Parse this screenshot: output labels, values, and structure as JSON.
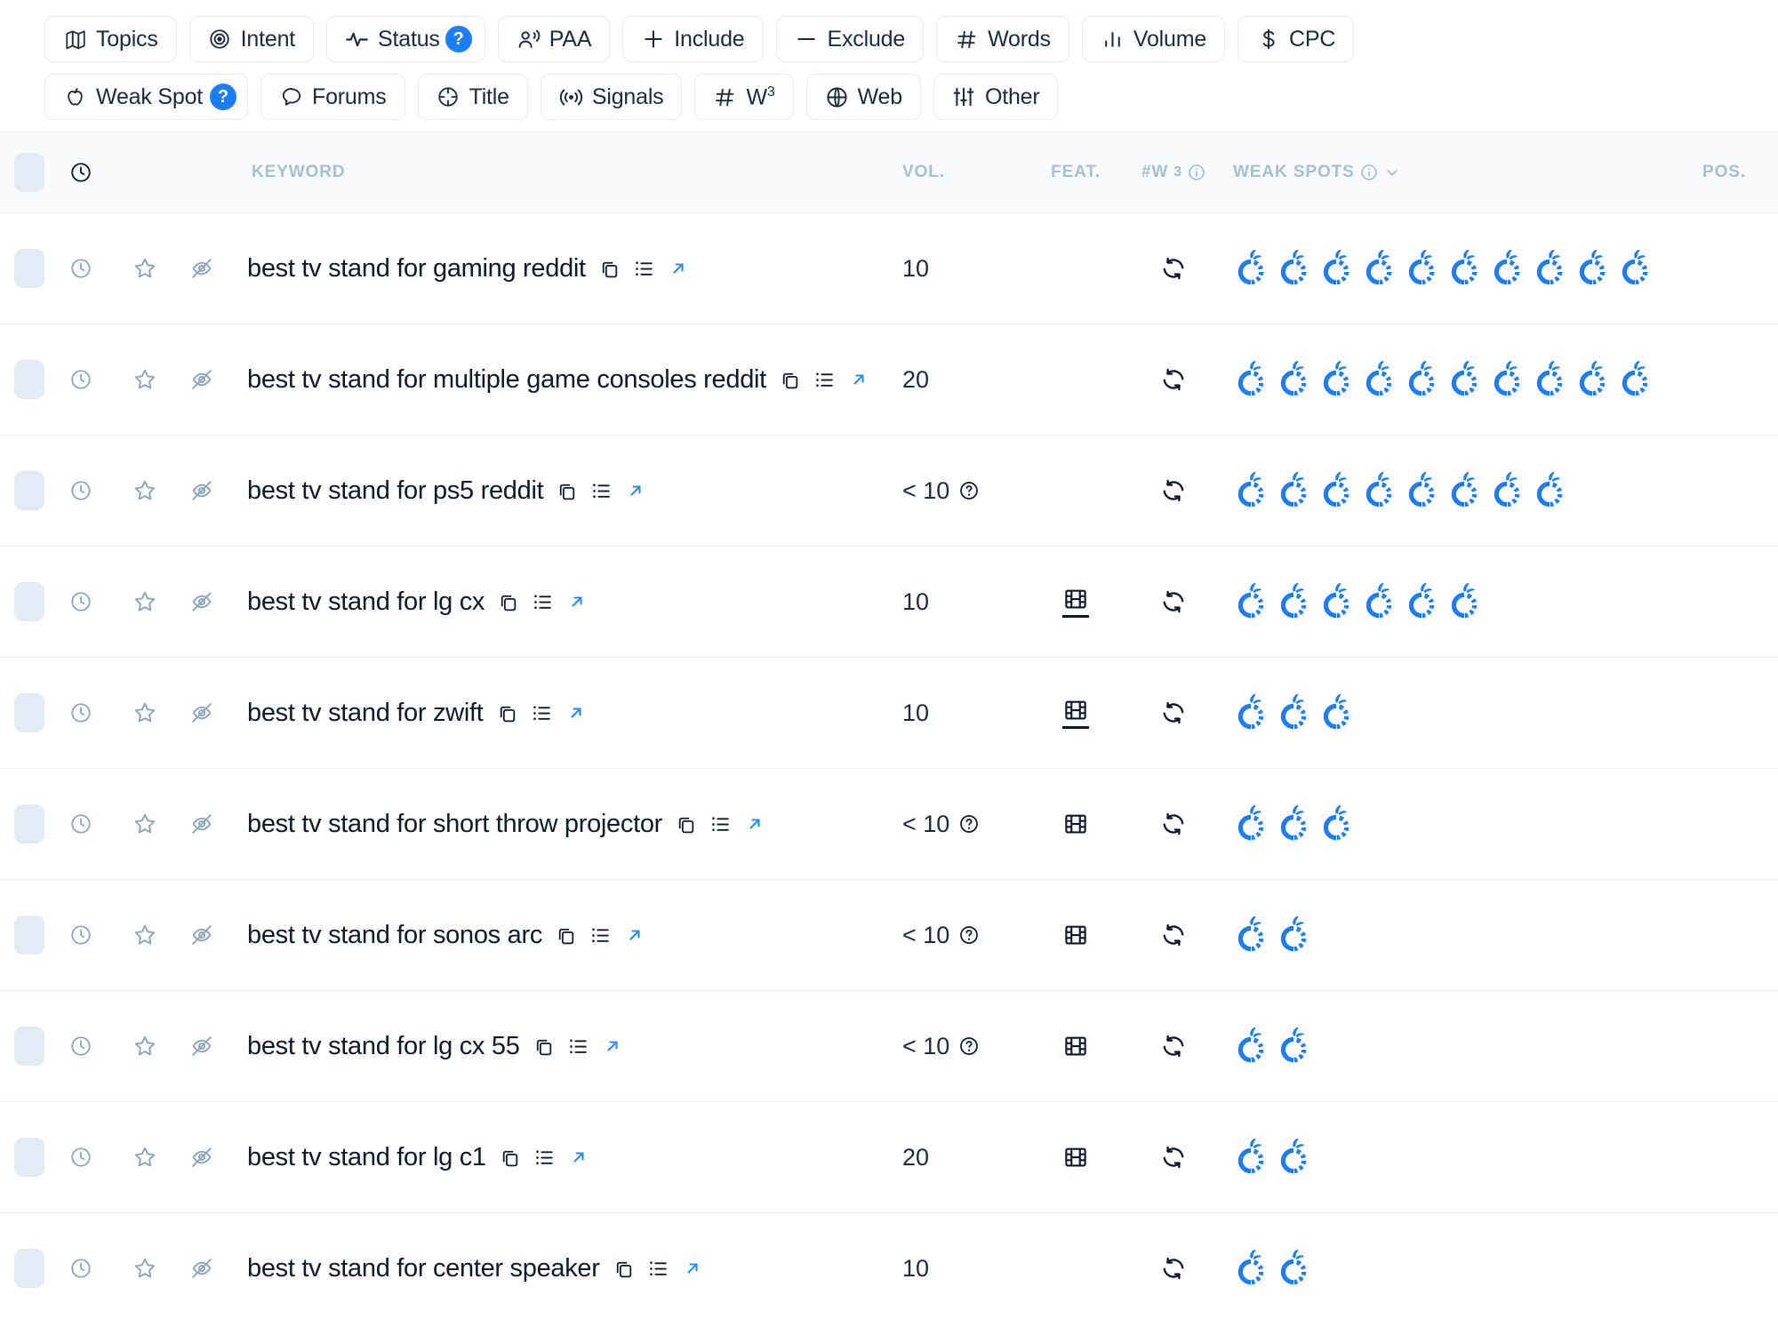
{
  "filters": {
    "accent_color": "#1d7df5",
    "row1": [
      {
        "label": "Topics",
        "icon": "map-icon",
        "badge": null
      },
      {
        "label": "Intent",
        "icon": "target-icon",
        "badge": null
      },
      {
        "label": "Status",
        "icon": "activity-icon",
        "badge": "?"
      },
      {
        "label": "PAA",
        "icon": "people-ask-icon",
        "badge": null
      },
      {
        "label": "Include",
        "icon": "plus-icon",
        "badge": null
      },
      {
        "label": "Exclude",
        "icon": "minus-icon",
        "badge": null
      },
      {
        "label": "Words",
        "icon": "hash-icon",
        "badge": null
      },
      {
        "label": "Volume",
        "icon": "bar-chart-icon",
        "badge": null
      },
      {
        "label": "CPC",
        "icon": "dollar-icon",
        "badge": null
      }
    ],
    "row2": [
      {
        "label": "Weak Spot",
        "icon": "apple-icon",
        "badge": "?"
      },
      {
        "label": "Forums",
        "icon": "chat-bubble-icon",
        "badge": null
      },
      {
        "label": "Title",
        "icon": "crosshair-icon",
        "badge": null
      },
      {
        "label": "Signals",
        "icon": "broadcast-icon",
        "badge": null
      },
      {
        "label": "W3",
        "icon": "hash-icon",
        "badge": null
      },
      {
        "label": "Web",
        "icon": "globe-icon",
        "badge": null
      },
      {
        "label": "Other",
        "icon": "sliders-icon",
        "badge": null
      }
    ]
  },
  "table": {
    "headers": {
      "keyword": "KEYWORD",
      "volume": "VOL.",
      "feature": "FEAT.",
      "w3": "#W",
      "w3_sup": "3",
      "weak_spots": "WEAK SPOTS",
      "position": "POS."
    },
    "rows": [
      {
        "keyword": "best tv stand for gaming reddit",
        "volume": "10",
        "volume_help": false,
        "feature": null,
        "feature_underline": false,
        "w3": "refresh-icon",
        "weak_spots": 10,
        "position": ""
      },
      {
        "keyword": "best tv stand for multiple game consoles reddit",
        "volume": "20",
        "volume_help": false,
        "feature": null,
        "feature_underline": false,
        "w3": "refresh-icon",
        "weak_spots": 10,
        "position": ""
      },
      {
        "keyword": "best tv stand for ps5 reddit",
        "volume": "< 10",
        "volume_help": true,
        "feature": null,
        "feature_underline": false,
        "w3": "refresh-icon",
        "weak_spots": 8,
        "position": ""
      },
      {
        "keyword": "best tv stand for lg cx",
        "volume": "10",
        "volume_help": false,
        "feature": "film-icon",
        "feature_underline": true,
        "w3": "refresh-icon",
        "weak_spots": 6,
        "position": ""
      },
      {
        "keyword": "best tv stand for zwift",
        "volume": "10",
        "volume_help": false,
        "feature": "film-icon",
        "feature_underline": true,
        "w3": "refresh-icon",
        "weak_spots": 3,
        "position": ""
      },
      {
        "keyword": "best tv stand for short throw projector",
        "volume": "< 10",
        "volume_help": true,
        "feature": "film-icon",
        "feature_underline": false,
        "w3": "refresh-icon",
        "weak_spots": 3,
        "position": ""
      },
      {
        "keyword": "best tv stand for sonos arc",
        "volume": "< 10",
        "volume_help": true,
        "feature": "film-icon",
        "feature_underline": false,
        "w3": "refresh-icon",
        "weak_spots": 2,
        "position": ""
      },
      {
        "keyword": "best tv stand for lg cx 55",
        "volume": "< 10",
        "volume_help": true,
        "feature": "film-icon",
        "feature_underline": false,
        "w3": "refresh-icon",
        "weak_spots": 2,
        "position": ""
      },
      {
        "keyword": "best tv stand for lg c1",
        "volume": "20",
        "volume_help": false,
        "feature": "film-icon",
        "feature_underline": false,
        "w3": "refresh-icon",
        "weak_spots": 2,
        "position": ""
      },
      {
        "keyword": "best tv stand for center speaker",
        "volume": "10",
        "volume_help": false,
        "feature": null,
        "feature_underline": false,
        "w3": "refresh-icon",
        "weak_spots": 2,
        "position": ""
      }
    ],
    "row_icons": [
      "checkbox",
      "clock-icon",
      "star-icon",
      "eye-off-icon"
    ],
    "keyword_actions": [
      "copy-icon",
      "list-icon",
      "external-link-icon"
    ],
    "weak_spot_color": "#1d7df5"
  }
}
